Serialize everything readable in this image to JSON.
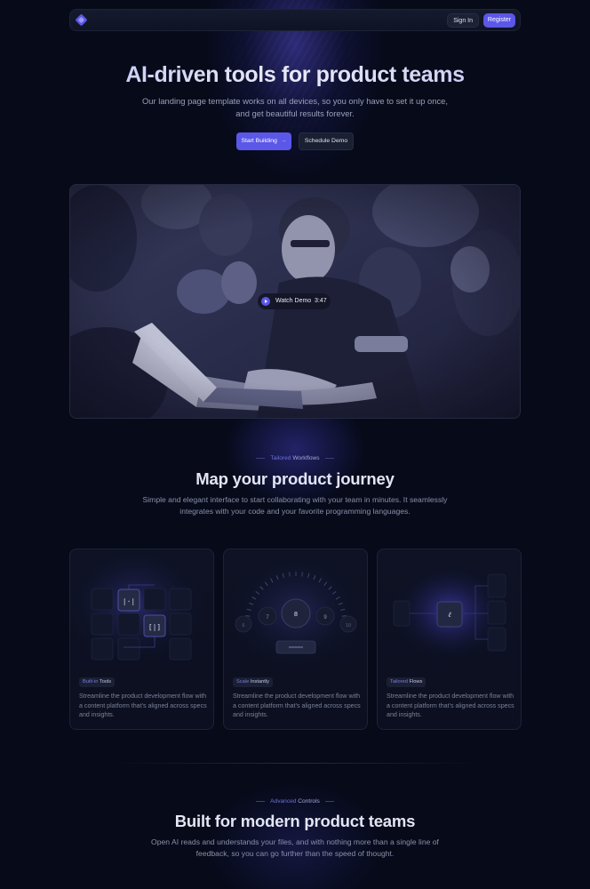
{
  "nav": {
    "signin_label": "Sign In",
    "register_label": "Register"
  },
  "hero": {
    "title": "AI-driven tools for product teams",
    "subtitle_line1": "Our landing page template works on all devices, so you only have to set it up once,",
    "subtitle_line2": "and get beautiful results forever.",
    "primary_button": "Start Building",
    "primary_arrow": "→",
    "secondary_button": "Schedule Demo"
  },
  "video": {
    "watch_label": "Watch Demo",
    "separator": "·",
    "duration": "3:47"
  },
  "workflows": {
    "eyebrow_prefix": "Tailored ",
    "eyebrow_highlight": "Workflows",
    "title": "Map your product journey",
    "subtitle_line1": "Simple and elegant interface to start collaborating with your team in minutes. It seamlessly",
    "subtitle_line2": "integrates with your code and your favorite programming languages."
  },
  "cards": [
    {
      "tag_prefix": "Built-in ",
      "tag_highlight": "Tools",
      "description": "Streamline the product development flow with a content platform that's aligned across specs and insights."
    },
    {
      "tag_prefix": "Scale ",
      "tag_highlight": "Instantly",
      "description": "Streamline the product development flow with a content platform that's aligned across specs and insights."
    },
    {
      "tag_prefix": "Tailored ",
      "tag_highlight": "Flows",
      "description": "Streamline the product development flow with a content platform that's aligned across specs and insights."
    }
  ],
  "dial_numbers": [
    "6",
    "7",
    "8",
    "9",
    "10"
  ],
  "controls": {
    "eyebrow_prefix": "Advanced ",
    "eyebrow_highlight": "Controls",
    "title": "Built for modern product teams",
    "subtitle_line1": "Open AI reads and understands your files, and with nothing more than a single line of",
    "subtitle_line2": "feedback, so you can go further than the speed of thought."
  },
  "colors": {
    "accent": "#5b57e8",
    "background": "#060a19"
  }
}
